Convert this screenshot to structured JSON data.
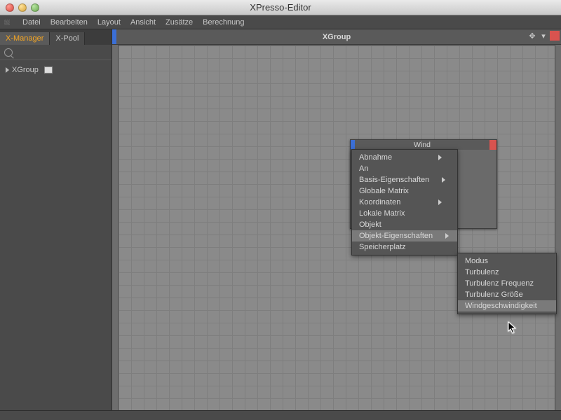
{
  "window": {
    "title": "XPresso-Editor"
  },
  "menubar": [
    "Datei",
    "Bearbeiten",
    "Layout",
    "Ansicht",
    "Zusätze",
    "Berechnung"
  ],
  "sidebar": {
    "tabs": [
      "X-Manager",
      "X-Pool"
    ],
    "activeTab": 0,
    "tree": {
      "root": "XGroup"
    }
  },
  "canvas": {
    "header": "XGroup",
    "node": {
      "title": "Wind"
    }
  },
  "contextMenu": {
    "items": [
      {
        "label": "Abnahme",
        "sub": true
      },
      {
        "label": "An",
        "sub": false
      },
      {
        "label": "Basis-Eigenschaften",
        "sub": true
      },
      {
        "label": "Globale Matrix",
        "sub": false
      },
      {
        "label": "Koordinaten",
        "sub": true
      },
      {
        "label": "Lokale Matrix",
        "sub": false
      },
      {
        "label": "Objekt",
        "sub": false
      },
      {
        "label": "Objekt-Eigenschaften",
        "sub": true,
        "highlight": true
      },
      {
        "label": "Speicherplatz",
        "sub": false
      }
    ]
  },
  "submenu": {
    "items": [
      {
        "label": "Modus"
      },
      {
        "label": "Turbulenz"
      },
      {
        "label": "Turbulenz Frequenz"
      },
      {
        "label": "Turbulenz Größe"
      },
      {
        "label": "Windgeschwindigkeit",
        "highlight": true
      }
    ]
  }
}
